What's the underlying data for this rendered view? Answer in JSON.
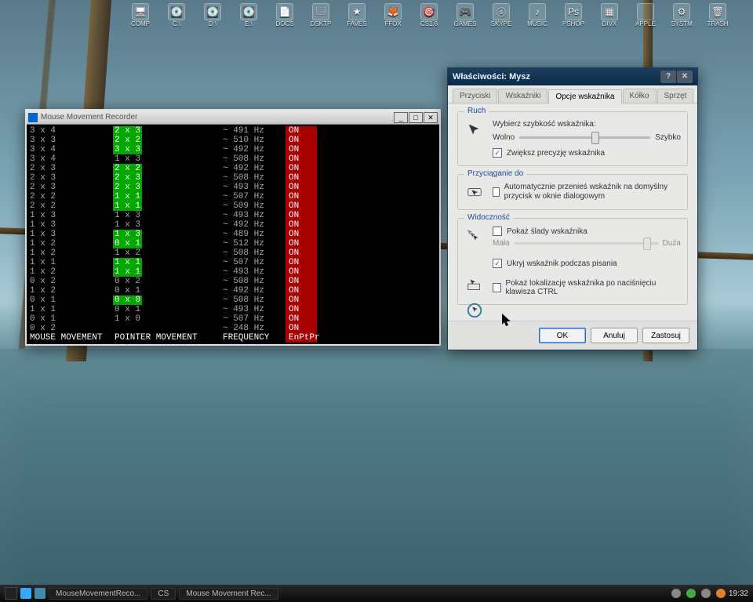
{
  "desktop": {
    "icons": [
      {
        "label": "COMP",
        "glyph": "🖥"
      },
      {
        "label": "C:\\",
        "glyph": "💽"
      },
      {
        "label": "D:\\",
        "glyph": "💽"
      },
      {
        "label": "E:\\",
        "glyph": "💽"
      },
      {
        "label": "DOCS",
        "glyph": "📄"
      },
      {
        "label": "DSKTP",
        "glyph": "🗔"
      },
      {
        "label": "FAVES",
        "glyph": "★"
      },
      {
        "label": "FFOX",
        "glyph": "🦊"
      },
      {
        "label": "CS1.6",
        "glyph": "🎯"
      },
      {
        "label": "GAMES",
        "glyph": "🎮"
      },
      {
        "label": "SKYPE",
        "glyph": "ⓢ"
      },
      {
        "label": "MUSIC",
        "glyph": "♪"
      },
      {
        "label": "PSHOP",
        "glyph": "Ps"
      },
      {
        "label": "DIVX",
        "glyph": "▦"
      },
      {
        "label": "APPLE",
        "glyph": ""
      },
      {
        "label": "SYSTM",
        "glyph": "⚙"
      },
      {
        "label": "TRASH",
        "glyph": "🗑"
      }
    ]
  },
  "console": {
    "title": "Mouse Movement Recorder",
    "headers": {
      "mm": "MOUSE MOVEMENT",
      "pm": "POINTER MOVEMENT",
      "fr": "FREQUENCY",
      "ep": "EnPtPr"
    },
    "rows": [
      {
        "mm": "3 x 4",
        "pm": "2 x 3",
        "hl": true,
        "fr": "~ 491 Hz",
        "on": "ON"
      },
      {
        "mm": "3 x 3",
        "pm": "2 x 2",
        "hl": true,
        "fr": "~ 510 Hz",
        "on": "ON"
      },
      {
        "mm": "3 x 4",
        "pm": "3 x 3",
        "hl": true,
        "fr": "~ 492 Hz",
        "on": "ON"
      },
      {
        "mm": "3 x 4",
        "pm": "1 x 3",
        "hl": false,
        "fr": "~ 508 Hz",
        "on": "ON"
      },
      {
        "mm": "2 x 3",
        "pm": "2 x 2",
        "hl": true,
        "fr": "~ 492 Hz",
        "on": "ON"
      },
      {
        "mm": "2 x 3",
        "pm": "2 x 3",
        "hl": true,
        "fr": "~ 508 Hz",
        "on": "ON"
      },
      {
        "mm": "2 x 3",
        "pm": "2 x 3",
        "hl": true,
        "fr": "~ 493 Hz",
        "on": "ON"
      },
      {
        "mm": "2 x 2",
        "pm": "1 x 1",
        "hl": true,
        "fr": "~ 507 Hz",
        "on": "ON"
      },
      {
        "mm": "2 x 2",
        "pm": "1 x 1",
        "hl": true,
        "fr": "~ 509 Hz",
        "on": "ON"
      },
      {
        "mm": "1 x 3",
        "pm": "1 x 3",
        "hl": false,
        "fr": "~ 493 Hz",
        "on": "ON"
      },
      {
        "mm": "1 x 3",
        "pm": "1 x 3",
        "hl": false,
        "fr": "~ 492 Hz",
        "on": "ON"
      },
      {
        "mm": "1 x 3",
        "pm": "1 x 3",
        "hl": true,
        "fr": "~ 489 Hz",
        "on": "ON"
      },
      {
        "mm": "1 x 2",
        "pm": "0 x 1",
        "hl": true,
        "fr": "~ 512 Hz",
        "on": "ON"
      },
      {
        "mm": "1 x 2",
        "pm": "1 x 2",
        "hl": false,
        "fr": "~ 508 Hz",
        "on": "ON"
      },
      {
        "mm": "1 x 1",
        "pm": "1 x 1",
        "hl": true,
        "fr": "~ 507 Hz",
        "on": "ON"
      },
      {
        "mm": "1 x 2",
        "pm": "1 x 1",
        "hl": true,
        "fr": "~ 493 Hz",
        "on": "ON"
      },
      {
        "mm": "0 x 2",
        "pm": "0 x 2",
        "hl": false,
        "fr": "~ 508 Hz",
        "on": "ON"
      },
      {
        "mm": "1 x 2",
        "pm": "0 x 1",
        "hl": false,
        "fr": "~ 492 Hz",
        "on": "ON"
      },
      {
        "mm": "0 x 1",
        "pm": "0 x 0",
        "hl": true,
        "fr": "~ 508 Hz",
        "on": "ON"
      },
      {
        "mm": "1 x 1",
        "pm": "0 x 1",
        "hl": false,
        "fr": "~ 493 Hz",
        "on": "ON"
      },
      {
        "mm": "0 x 1",
        "pm": "1 x 0",
        "hl": false,
        "fr": "~ 507 Hz",
        "on": "ON"
      },
      {
        "mm": "0 x 2",
        "pm": " ",
        "hl": false,
        "fr": "~ 248 Hz",
        "on": "ON"
      }
    ]
  },
  "props": {
    "title": "Właściwości: Mysz",
    "tabs": [
      "Przyciski",
      "Wskaźniki",
      "Opcje wskaźnika",
      "Kółko",
      "Sprzęt"
    ],
    "active_tab": 2,
    "ruch": {
      "legend": "Ruch",
      "label": "Wybierz szybkość wskaźnika:",
      "slow": "Wolno",
      "fast": "Szybko",
      "speed_pos": 0.55,
      "precision": {
        "checked": true,
        "label": "Zwiększ precyzję wskaźnika"
      }
    },
    "snap": {
      "legend": "Przyciąganie do",
      "auto": {
        "checked": false,
        "label": "Automatycznie przenieś wskaźnik na domyślny przycisk w oknie dialogowym"
      }
    },
    "vis": {
      "legend": "Widoczność",
      "trails": {
        "checked": false,
        "label": "Pokaż ślady wskaźnika"
      },
      "trails_slow": "Mała",
      "trails_fast": "Duża",
      "trails_pos": 0.9,
      "hide": {
        "checked": true,
        "label": "Ukryj wskaźnik podczas pisania"
      },
      "ctrl": {
        "checked": false,
        "label": "Pokaż lokalizację wskaźnika po naciśnięciu klawisza CTRL"
      }
    },
    "buttons": {
      "ok": "OK",
      "cancel": "Anuluj",
      "apply": "Zastosuj"
    }
  },
  "taskbar": {
    "items": [
      {
        "label": "MouseMovementReco..."
      },
      {
        "label": "CS"
      },
      {
        "label": "Mouse Movement Rec..."
      }
    ],
    "clock": "19:32"
  }
}
